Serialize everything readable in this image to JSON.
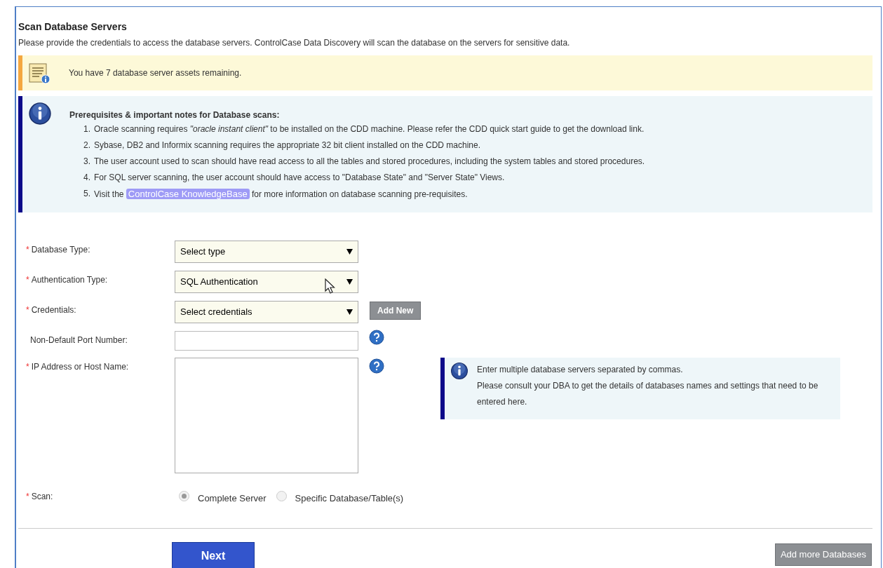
{
  "title": "Scan Database Servers",
  "description": "Please provide the credentials to access the database servers. ControlCase Data Discovery will scan the database on the servers for sensitive data.",
  "assets_banner": {
    "text": "You have 7 database server assets remaining."
  },
  "prerequisites": {
    "heading": "Prerequisites & important notes for Database scans:",
    "items": [
      {
        "number": "1.",
        "text": "Oracle scanning requires *\"oracle instant client\"* to be installed on the CDD machine. Please refer the CDD quick start guide to get the download link."
      },
      {
        "number": "2.",
        "text": "Sybase, DB2 and Informix scanning requires the appropriate 32 bit client installed on the CDD machine."
      },
      {
        "number": "3.",
        "text": "The user account used to scan should have read access to all the tables and stored procedures, including the system tables and stored procedures."
      },
      {
        "number": "4.",
        "text": "For SQL server scanning, the user account should have access to \"Database State\" and \"Server State\" Views."
      },
      {
        "number": "5.",
        "text": "Visit the",
        "link": "ControlCase KnowledgeBase",
        "after": "for more information on database scanning pre-requisites."
      }
    ]
  },
  "form": [
    {
      "kind": "select",
      "marker": "*",
      "label": "Database Type:",
      "value": "Select type"
    },
    {
      "kind": "select",
      "marker": "*",
      "label": "Authentication Type:",
      "value": "SQL Authentication",
      "cursor": true
    },
    {
      "kind": "select",
      "marker": "*",
      "label": "Credentials:",
      "value": "Select credentials",
      "button": "Add New"
    },
    {
      "kind": "input",
      "label": "Non-Default Port Number:",
      "help": true
    },
    {
      "kind": "textarea",
      "marker": "*",
      "label": "IP Address or Host Name:",
      "help": true,
      "note": [
        "Enter multiple database servers separated by commas.",
        "Please consult your DBA to get the details of databases names and settings that need to be entered here."
      ]
    },
    {
      "kind": "radio",
      "marker": "*",
      "label": "Scan:",
      "options": [
        {
          "label": "Complete Server",
          "selected": true
        },
        {
          "label": "Specific Database/Table(s)",
          "selected": false
        }
      ]
    }
  ],
  "next_button": "Next",
  "add_more_button": "Add more Databases"
}
